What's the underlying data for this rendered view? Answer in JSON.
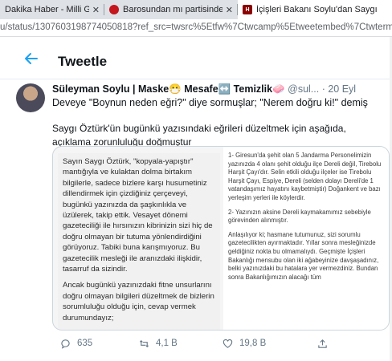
{
  "browser": {
    "tabs": [
      {
        "title": "Dakika Haber - Milli Gaze",
        "close": "✕"
      },
      {
        "title": "Barosundan mı partisinden mı",
        "close": "✕"
      },
      {
        "title": "İçişleri Bakanı Soylu'dan Saygı",
        "close": "✕"
      }
    ],
    "url": "u/status/1307603198774050818?ref_src=twsrc%5Etfw%7Ctwcamp%5Etweetembed%7Ctwterm%5E130"
  },
  "header": {
    "back_icon": "arrow-left-icon",
    "title": "Tweetle"
  },
  "tweet": {
    "name": "Süleyman Soylu | Maske😷 Mesafe↔️ Temizlik🧼",
    "handle": "@sul...",
    "date": "· 20 Eyl",
    "line1": "Deveye \"Boynun neden eğri?\" diye sormuşlar; \"Nerem doğru ki!\" demiş",
    "line2": "Saygı Öztürk'ün bugünkü yazısındaki eğrileri düzeltmek için aşağıda, açıklama zorunluluğu doğmuştur"
  },
  "media": {
    "left_paragraphs": [
      "Sayın Saygı Öztürk, \"kopyala-yapıştır\" mantığıyla ve kulaktan dolma birtakım bilgilerle, sadece bizlere karşı husumetiniz dillendirmek için çizdiğiniz çerçeveyi, bugünkü yazınızda da şaşkınlıkla ve üzülerek, takip ettik. Vesayet dönemi gazeteciliği ile hırsınızın kibrinizin sizi hiç de doğru olmayan bir tutuma yönlendirdiğini görüyoruz. Tabiki buna karışmıyoruz. Bu gazetecilik mesleği ile aranızdaki ilişkidir, tasarruf da sizindir.",
      "Ancak bugünkü yazınızdaki fitne unsurlarını doğru olmayan bilgileri düzeltmek de bizlerin sorumluluğu olduğu için, cevap vermek durumundayız;"
    ],
    "right_paragraphs": [
      "1- Giresun'da şehit olan 5 Jandarma Personelimizin yazınızda 4 olanı şehit olduğu ilçe Dereli değil, Tirebolu Harşit Çayı'dır. Selin etkili olduğu ilçeler ise Tirebolu Harşit Çayı, Espiye, Dereli (selden dolayı Dereli'de 1 vatandaşımız hayatını kaybetmiştir) Doğankent ve bazı yerleşim yerleri ile köylerdir.",
      "2- Yazınızın aksine Dereli kaymakamımız sebebiyle görevinden alınmıştır.",
      "Anlaşılıyor ki; hasmane tutumunuz, sizi sorumlu gazetecilikten ayırmaktadır. Yıllar sonra mesleğinizde geldiğiniz nokta bu olmamalıydı. Geçmişte İçişleri Bakanlığı mensubu olan iki ağabeyinize davşaşadınız, belki yazınızdaki bu hatalara yer vermezdiniz. Bundan sonra Bakanlığımızın alacağı tüm"
    ]
  },
  "actions": {
    "reply_count": "635",
    "retweet_count": "4,1 B",
    "like_count": "19,8 B",
    "reply_icon": "comment-icon",
    "retweet_icon": "retweet-icon",
    "like_icon": "heart-icon",
    "share_icon": "share-icon"
  },
  "colors": {
    "accent": "#1da1f2",
    "muted": "#657786"
  }
}
